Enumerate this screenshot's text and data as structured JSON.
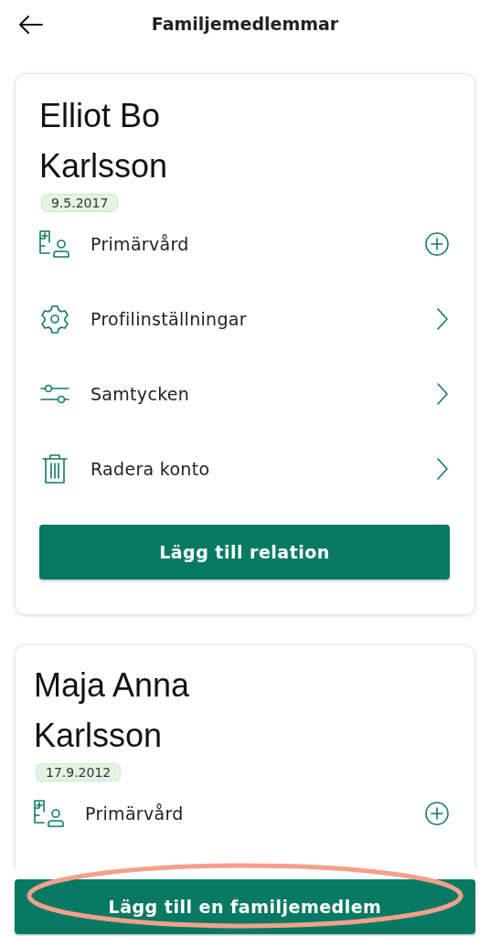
{
  "header": {
    "title": "Familjemedlemmar"
  },
  "members": [
    {
      "name": "Elliot Bo Karlsson",
      "birth_date": "9.5.2017",
      "rows": [
        {
          "kind": "primary-care",
          "label": "Primärvård"
        },
        {
          "kind": "settings",
          "label": "Profilinställningar"
        },
        {
          "kind": "consents",
          "label": "Samtycken"
        },
        {
          "kind": "delete",
          "label": "Radera konto"
        }
      ],
      "button": "Lägg till relation"
    },
    {
      "name": "Maja Anna Karlsson",
      "birth_date": "17.9.2012",
      "rows": [
        {
          "kind": "primary-care",
          "label": "Primärvård"
        }
      ]
    }
  ],
  "bottom_button": {
    "label": "Lägg till en familjemedlem",
    "highlighted": true
  }
}
